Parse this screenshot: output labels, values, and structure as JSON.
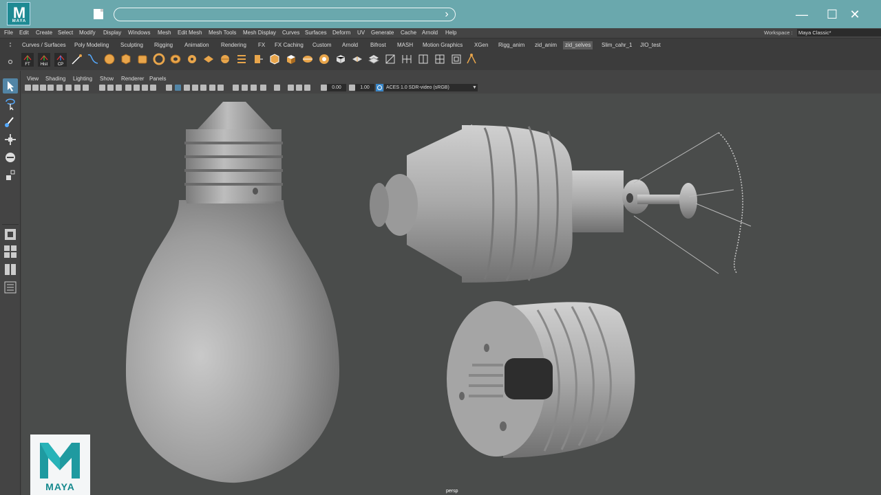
{
  "title_bar": {
    "app_icon_letter": "M",
    "app_icon_text": "MAYA"
  },
  "menubar": {
    "items": [
      "File",
      "Edit",
      "Create",
      "Select",
      "Modify",
      "Display",
      "Windows",
      "Mesh",
      "Edit Mesh",
      "Mesh Tools",
      "Mesh Display",
      "Curves",
      "Surfaces",
      "Deform",
      "UV",
      "Generate",
      "Cache",
      "Arnold",
      "Help"
    ],
    "workspace_label": "Workspace :",
    "workspace_value": "Maya Classic*"
  },
  "shelf": {
    "tabs": [
      "Curves / Surfaces",
      "Poly Modeling",
      "Sculpting",
      "Rigging",
      "Animation",
      "Rendering",
      "FX",
      "FX Caching",
      "Custom",
      "Arnold",
      "Bifrost",
      "MASH",
      "Motion Graphics",
      "XGen",
      "Rigg_anim",
      "zid_anim",
      "zid_selves",
      "Slim_cahr_1",
      "JIO_test"
    ],
    "active_tab": "zid_selves",
    "label_buttons": [
      "FT",
      "Hist",
      "CP"
    ]
  },
  "panel": {
    "menus": [
      "View",
      "Shading",
      "Lighting",
      "Show",
      "Renderer",
      "Panels"
    ],
    "exposure": "0.00",
    "gamma": "1.00",
    "color_space": "ACES 1.0 SDR-video (sRGB)",
    "camera": "persp"
  },
  "logo": {
    "letter": "M",
    "text": "MAYA"
  },
  "colors": {
    "titlebar": "#6aa8ad",
    "ui_bg": "#444444",
    "viewport_bg": "#4a4c4b",
    "accent": "#e8a54b",
    "selected_tool": "#5285a6"
  }
}
